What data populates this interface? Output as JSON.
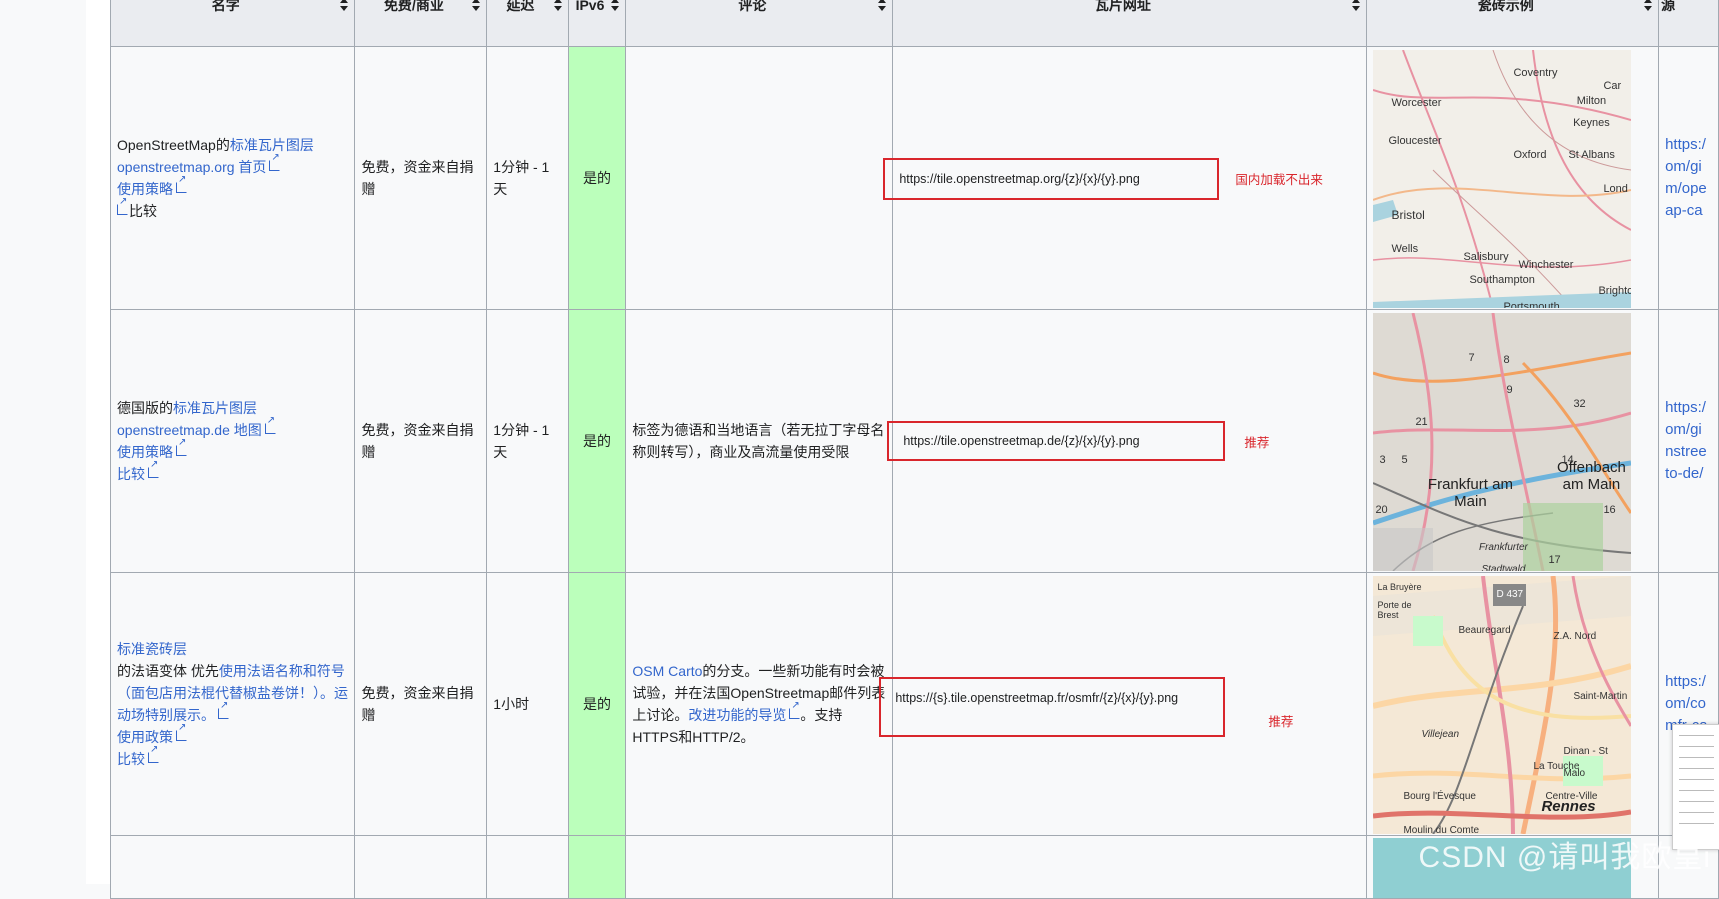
{
  "headers": [
    "名字",
    "免费/商业",
    "延迟",
    "IPv6",
    "评论",
    "瓦片网址",
    "瓷砖示例",
    "源"
  ],
  "rows": [
    {
      "name_plain": "OpenStreetMap的",
      "name_link": "标准瓦片图层",
      "home_link": "openstreetmap.org 首页",
      "policy_link": "使用策略",
      "compare": "比较",
      "free": "免费，资金来自捐赠",
      "latency": "1分钟 - 1天",
      "ipv6": "是的",
      "comment": "",
      "url": "https://tile.openstreetmap.org/{z}/{x}/{y}.png",
      "note": "国内加载不出来",
      "source_lines": [
        "https:/",
        "om/gi",
        "m/ope",
        "ap-ca"
      ]
    },
    {
      "name_plain": "德国版的",
      "name_link": "标准瓦片图层",
      "home_link": "openstreetmap.de 地图",
      "policy_link": "使用策略",
      "compare": "比较",
      "free": "免费，资金来自捐赠",
      "latency": "1分钟 - 1天",
      "ipv6": "是的",
      "comment": "标签为德语和当地语言（若无拉丁字母名称则转写），商业及高流量使用受限",
      "url": "https://tile.openstreetmap.de/{z}/{x}/{y}.png",
      "note": "推荐",
      "source_lines": [
        "https:/",
        "om/gi",
        "nstree",
        "to-de/"
      ]
    },
    {
      "name_link": "标准瓷砖层",
      "name_plain": "的法语变体 优先",
      "name_link2": "使用法语名称和符号（面包店用法棍代替椒盐卷饼！）。运动场特别展示。",
      "policy_link": "使用政策",
      "compare": "比较",
      "free": "免费，资金来自捐赠",
      "latency": "1小时",
      "ipv6": "是的",
      "comment_link": "OSM Carto",
      "comment_text": "的分支。一些新功能有时会被试验，并在法国OpenStreetmap邮件列表上讨论。",
      "comment_link2": "改进功能的导览",
      "comment_text2": "。支持HTTPS和HTTP/2。",
      "url": "https://{s}.tile.openstreetmap.fr/osmfr/{z}/{x}/{y}.png",
      "note": "推荐",
      "source_lines": [
        "https:/",
        "om/co",
        "mfr-ca"
      ]
    }
  ],
  "map1_labels": [
    "Coventry",
    "Worcester",
    "Milton Keynes",
    "Gloucester",
    "Oxford",
    "St Albans",
    "Lond",
    "Bristol",
    "Wells",
    "Salisbury",
    "Winchester",
    "Southampton",
    "Brighto",
    "Portsmouth",
    "Car"
  ],
  "map2_labels": [
    "Frankfurt am Main",
    "Offenbach am Main",
    "Frankfurter Stadtwald",
    "21",
    "5",
    "3",
    "7",
    "8",
    "9",
    "32",
    "14",
    "16",
    "17",
    "20"
  ],
  "map3_labels": [
    "Rennes",
    "Beauregard",
    "Z.A. Nord",
    "Villejean",
    "Saint-Martin",
    "La Touche",
    "Centre-Ville",
    "Dinan - St Malo",
    "Bourg l'Évesque",
    "Moulin du Comte",
    "D 437",
    "Porte de Brest",
    "La Bruyère"
  ],
  "watermark": "CSDN @请叫我欧皇i",
  "colors": {
    "link": "#3366cc",
    "ipv6_bg": "#bbffbb",
    "annotation": "#d9262c",
    "header_bg": "#eaecf0"
  }
}
